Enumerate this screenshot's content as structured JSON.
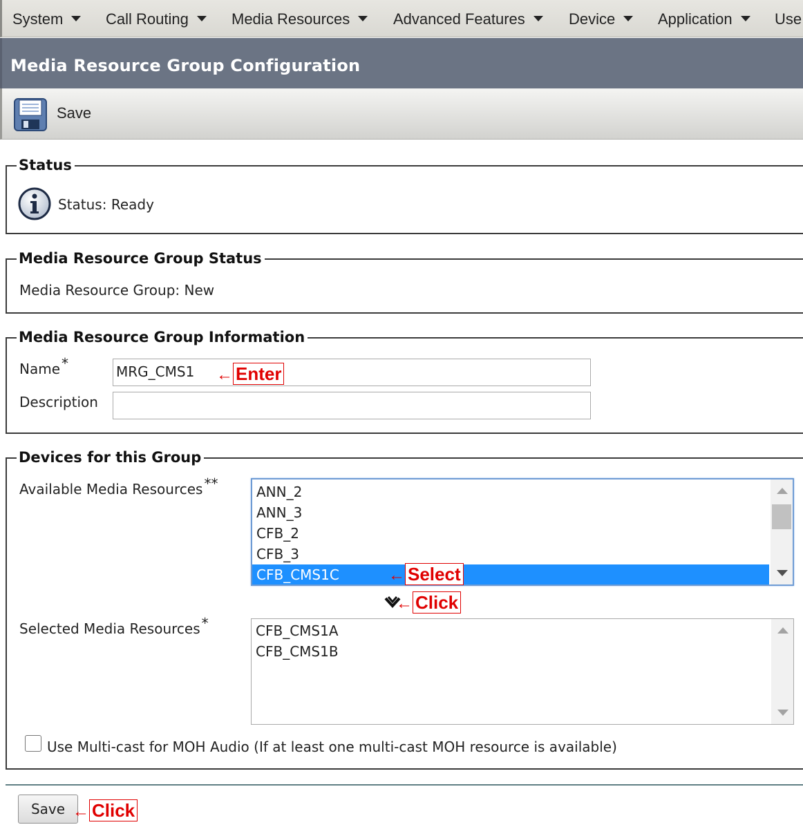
{
  "menu": {
    "items": [
      "System",
      "Call Routing",
      "Media Resources",
      "Advanced Features",
      "Device",
      "Application",
      "Use"
    ]
  },
  "page_title": "Media Resource Group Configuration",
  "toolbar": {
    "save_label": "Save"
  },
  "status_section": {
    "legend": "Status",
    "text": "Status: Ready"
  },
  "group_status_section": {
    "legend": "Media Resource Group Status",
    "text": "Media Resource Group: New"
  },
  "info_section": {
    "legend": "Media Resource Group Information",
    "name_label": "Name",
    "name_required_mark": "*",
    "name_value": "MRG_CMS1",
    "description_label": "Description",
    "description_value": ""
  },
  "devices_section": {
    "legend": "Devices for this Group",
    "available_label": "Available Media Resources",
    "available_required_mark": "**",
    "available_options": [
      "ANN_2",
      "ANN_3",
      "CFB_2",
      "CFB_3",
      "CFB_CMS1C"
    ],
    "available_selected": "CFB_CMS1C",
    "selected_label": "Selected Media Resources",
    "selected_required_mark": "*",
    "selected_options": [
      "CFB_CMS1A",
      "CFB_CMS1B"
    ],
    "multicast_label": "Use Multi-cast for MOH Audio (If at least one multi-cast MOH resource is available)",
    "multicast_checked": false
  },
  "bottom": {
    "save_label": "Save"
  },
  "annotations": {
    "enter": "Enter",
    "select": "Select",
    "click_move": "Click",
    "click_save": "Click",
    "arrow": "←"
  },
  "colors": {
    "menubar": "#dedcd6",
    "titlebar": "#6b7484",
    "selection": "#1e90ff",
    "annotation": "#e00000"
  }
}
